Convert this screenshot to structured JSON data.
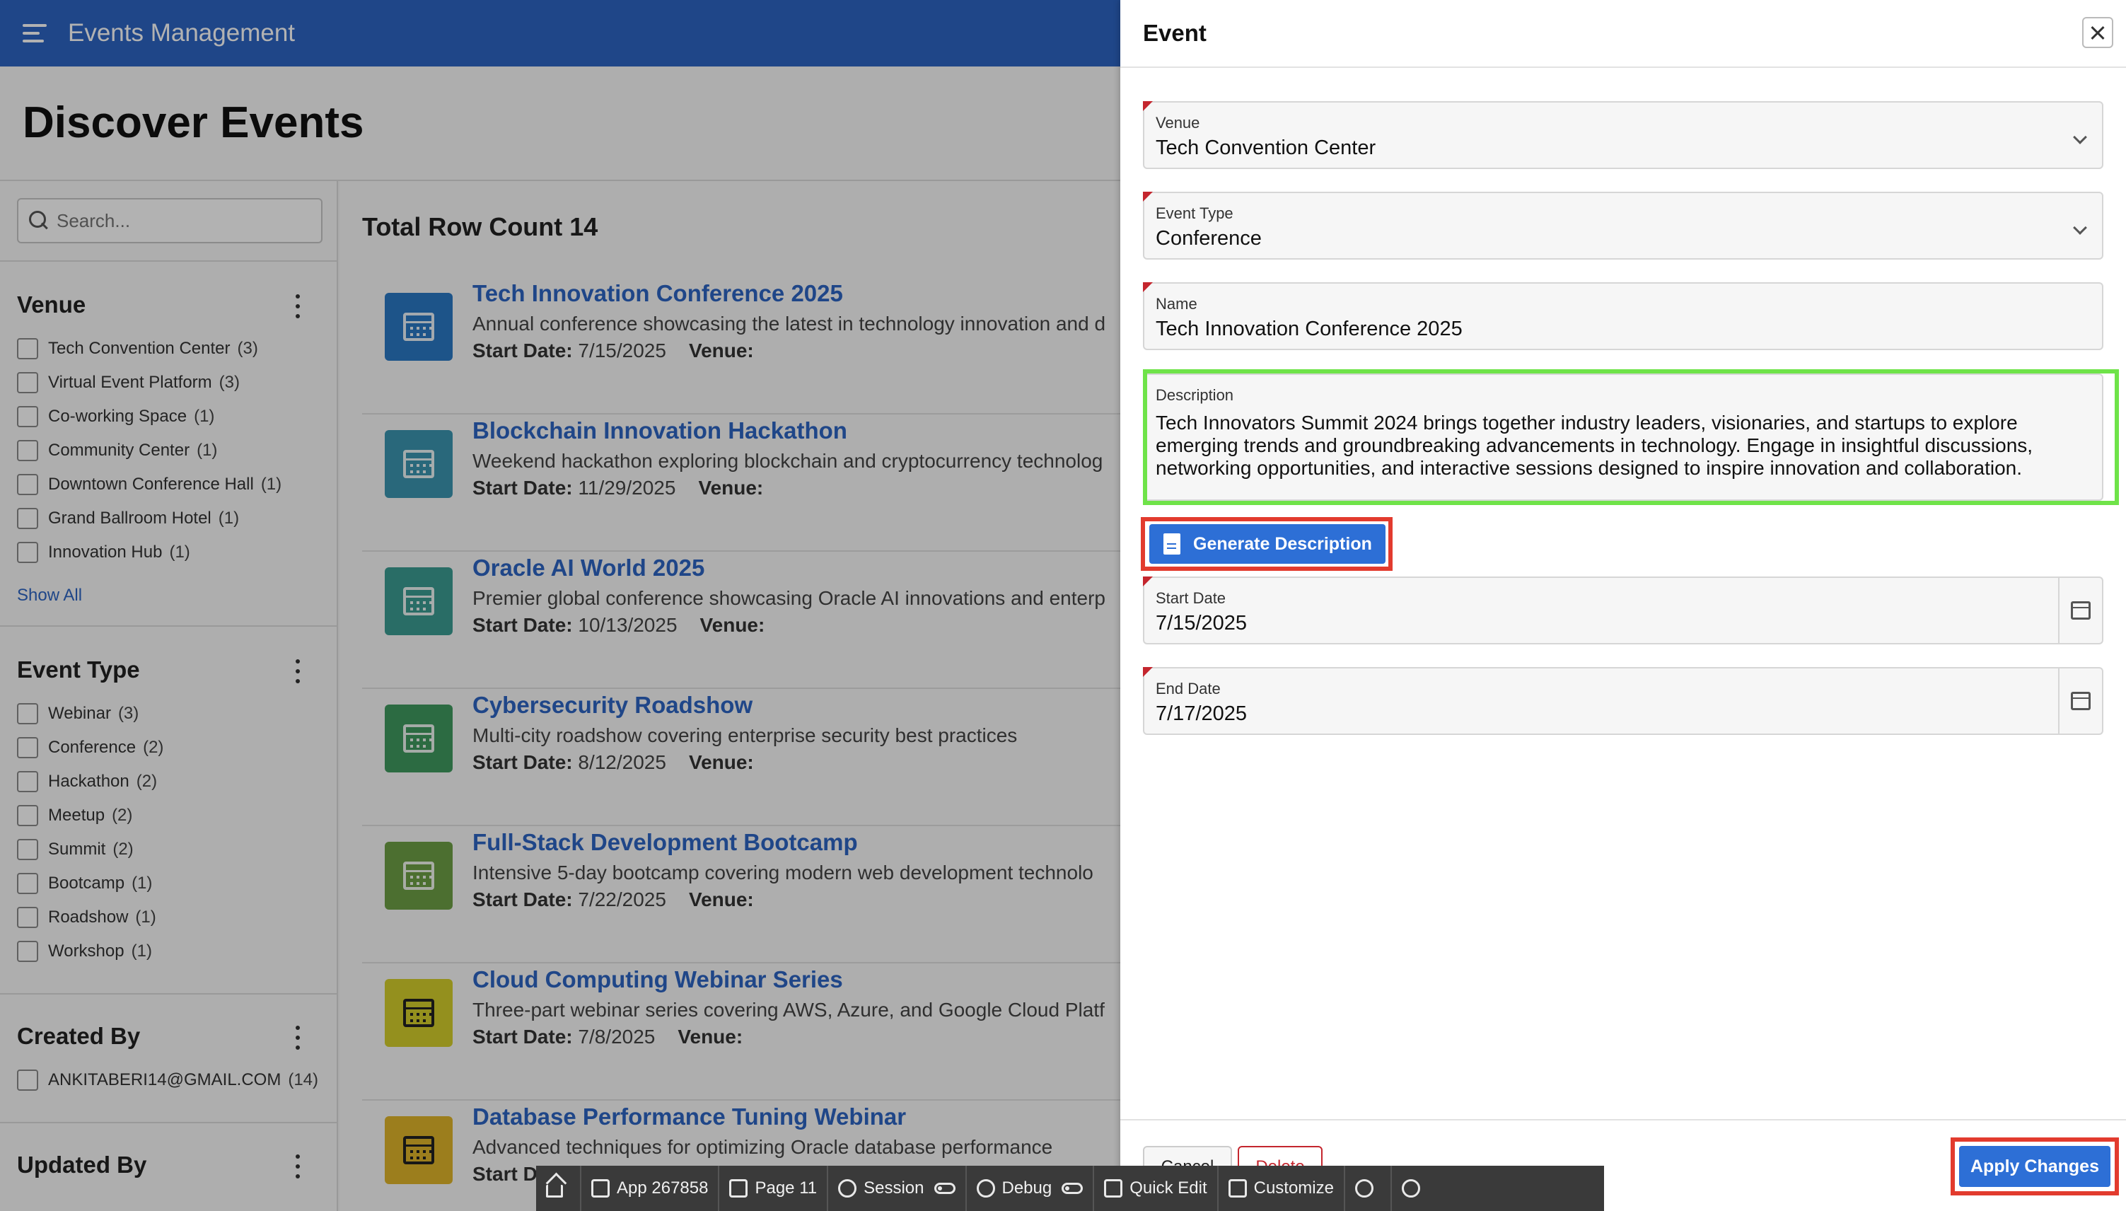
{
  "app": {
    "title": "Events Management"
  },
  "page": {
    "title": "Discover Events"
  },
  "search": {
    "placeholder": "Search..."
  },
  "facets": {
    "venue": {
      "title": "Venue",
      "items": [
        {
          "label": "Tech Convention Center",
          "count": "(3)"
        },
        {
          "label": "Virtual Event Platform",
          "count": "(3)"
        },
        {
          "label": "Co-working Space",
          "count": "(1)"
        },
        {
          "label": "Community Center",
          "count": "(1)"
        },
        {
          "label": "Downtown Conference Hall",
          "count": "(1)"
        },
        {
          "label": "Grand Ballroom Hotel",
          "count": "(1)"
        },
        {
          "label": "Innovation Hub",
          "count": "(1)"
        }
      ],
      "show_all": "Show All"
    },
    "event_type": {
      "title": "Event Type",
      "items": [
        {
          "label": "Webinar",
          "count": "(3)"
        },
        {
          "label": "Conference",
          "count": "(2)"
        },
        {
          "label": "Hackathon",
          "count": "(2)"
        },
        {
          "label": "Meetup",
          "count": "(2)"
        },
        {
          "label": "Summit",
          "count": "(2)"
        },
        {
          "label": "Bootcamp",
          "count": "(1)"
        },
        {
          "label": "Roadshow",
          "count": "(1)"
        },
        {
          "label": "Workshop",
          "count": "(1)"
        }
      ]
    },
    "created_by": {
      "title": "Created By",
      "items": [
        {
          "label": "ANKITABERI14@GMAIL.COM",
          "count": "(14)"
        }
      ]
    },
    "updated_by": {
      "title": "Updated By"
    }
  },
  "results": {
    "total": "Total Row Count 14",
    "start_label": "Start Date:",
    "venue_label": "Venue:",
    "items": [
      {
        "title": "Tech Innovation Conference 2025",
        "desc": "Annual conference showcasing the latest in technology innovation and d",
        "start": "7/15/2025",
        "color": "#2a79c4"
      },
      {
        "title": "Blockchain Innovation Hackathon",
        "desc": "Weekend hackathon exploring blockchain and cryptocurrency technolog",
        "start": "11/29/2025",
        "color": "#3b95b0"
      },
      {
        "title": "Oracle AI World 2025",
        "desc": "Premier global conference showcasing Oracle AI innovations and enterp",
        "start": "10/13/2025",
        "color": "#3c9c92"
      },
      {
        "title": "Cybersecurity Roadshow",
        "desc": "Multi-city roadshow covering enterprise security best practices",
        "start": "8/12/2025",
        "color": "#3f9a5f"
      },
      {
        "title": "Full-Stack Development Bootcamp",
        "desc": "Intensive 5-day bootcamp covering modern web development technolo",
        "start": "7/22/2025",
        "color": "#6da045"
      },
      {
        "title": "Cloud Computing Webinar Series",
        "desc": "Three-part webinar series covering AWS, Azure, and Google Cloud Platf",
        "start": "7/8/2025",
        "color": "#d4cf2c"
      },
      {
        "title": "Database Performance Tuning Webinar",
        "desc": "Advanced techniques for optimizing Oracle database performance",
        "start": "",
        "color": "#e0b52a"
      }
    ],
    "last_meta_prefix": "Start D"
  },
  "dialog": {
    "title": "Event",
    "venue": {
      "label": "Venue",
      "value": "Tech Convention Center"
    },
    "event_type": {
      "label": "Event Type",
      "value": "Conference"
    },
    "name": {
      "label": "Name",
      "value": "Tech Innovation Conference 2025"
    },
    "description": {
      "label": "Description",
      "value": "Tech Innovators Summit 2024 brings together industry leaders, visionaries, and startups to explore emerging trends and groundbreaking advancements in technology. Engage in insightful discussions, networking opportunities, and interactive sessions designed to inspire innovation and collaboration."
    },
    "generate_button": "Generate Description",
    "start_date": {
      "label": "Start Date",
      "value": "7/15/2025"
    },
    "end_date": {
      "label": "End Date",
      "value": "7/17/2025"
    },
    "cancel": "Cancel",
    "delete": "Delete",
    "apply": "Apply Changes"
  },
  "devbar": {
    "app": "App 267858",
    "page": "Page 11",
    "session": "Session",
    "debug": "Debug",
    "quick_edit": "Quick Edit",
    "customize": "Customize"
  },
  "colors": {
    "header_blue": "#2d65c3",
    "button_blue": "#2d6fd6",
    "highlight_green": "#6fe349",
    "highlight_red": "#e23b2e",
    "required_red": "#c4262e"
  }
}
